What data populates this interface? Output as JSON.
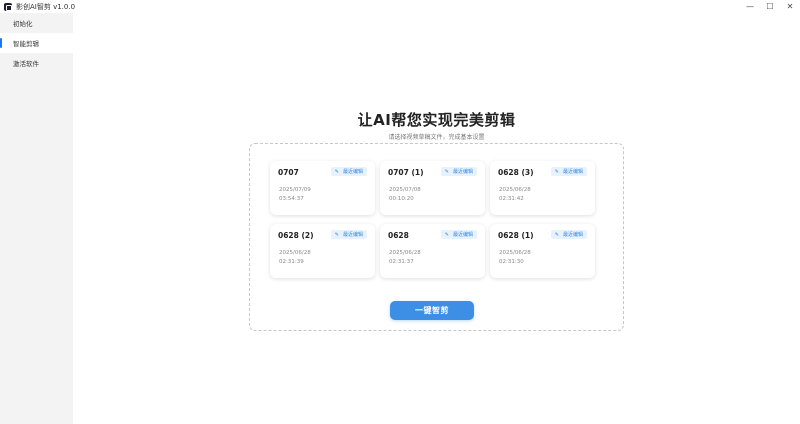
{
  "window": {
    "title": "影创AI智剪 v1.0.0",
    "controls": {
      "minimize": "—",
      "maximize": "☐",
      "close": "✕"
    }
  },
  "sidebar": {
    "items": [
      {
        "label": "初始化",
        "active": false
      },
      {
        "label": "智能剪辑",
        "active": true
      },
      {
        "label": "激活软件",
        "active": false
      }
    ]
  },
  "main": {
    "title": "让AI帮您实现完美剪辑",
    "subtitle": "请选择视频草稿文件，完成基本设置",
    "badge_label": "最近编辑",
    "badge_icon": "✎",
    "projects": [
      {
        "name": "0707",
        "date": "2025/07/09",
        "time": "03:54:37"
      },
      {
        "name": "0707 (1)",
        "date": "2025/07/08",
        "time": "00:10:20"
      },
      {
        "name": "0628 (3)",
        "date": "2025/06/28",
        "time": "02:31:42"
      },
      {
        "name": "0628 (2)",
        "date": "2025/06/28",
        "time": "02:31:39"
      },
      {
        "name": "0628",
        "date": "2025/06/28",
        "time": "02:31:37"
      },
      {
        "name": "0628 (1)",
        "date": "2025/06/28",
        "time": "02:31:30"
      }
    ],
    "cta_label": "一键智剪"
  },
  "colors": {
    "accent": "#3d8fe6",
    "badge_bg": "#e8f2fd",
    "sidebar_bg": "#f3f3f3",
    "active_indicator": "#1677ff"
  }
}
